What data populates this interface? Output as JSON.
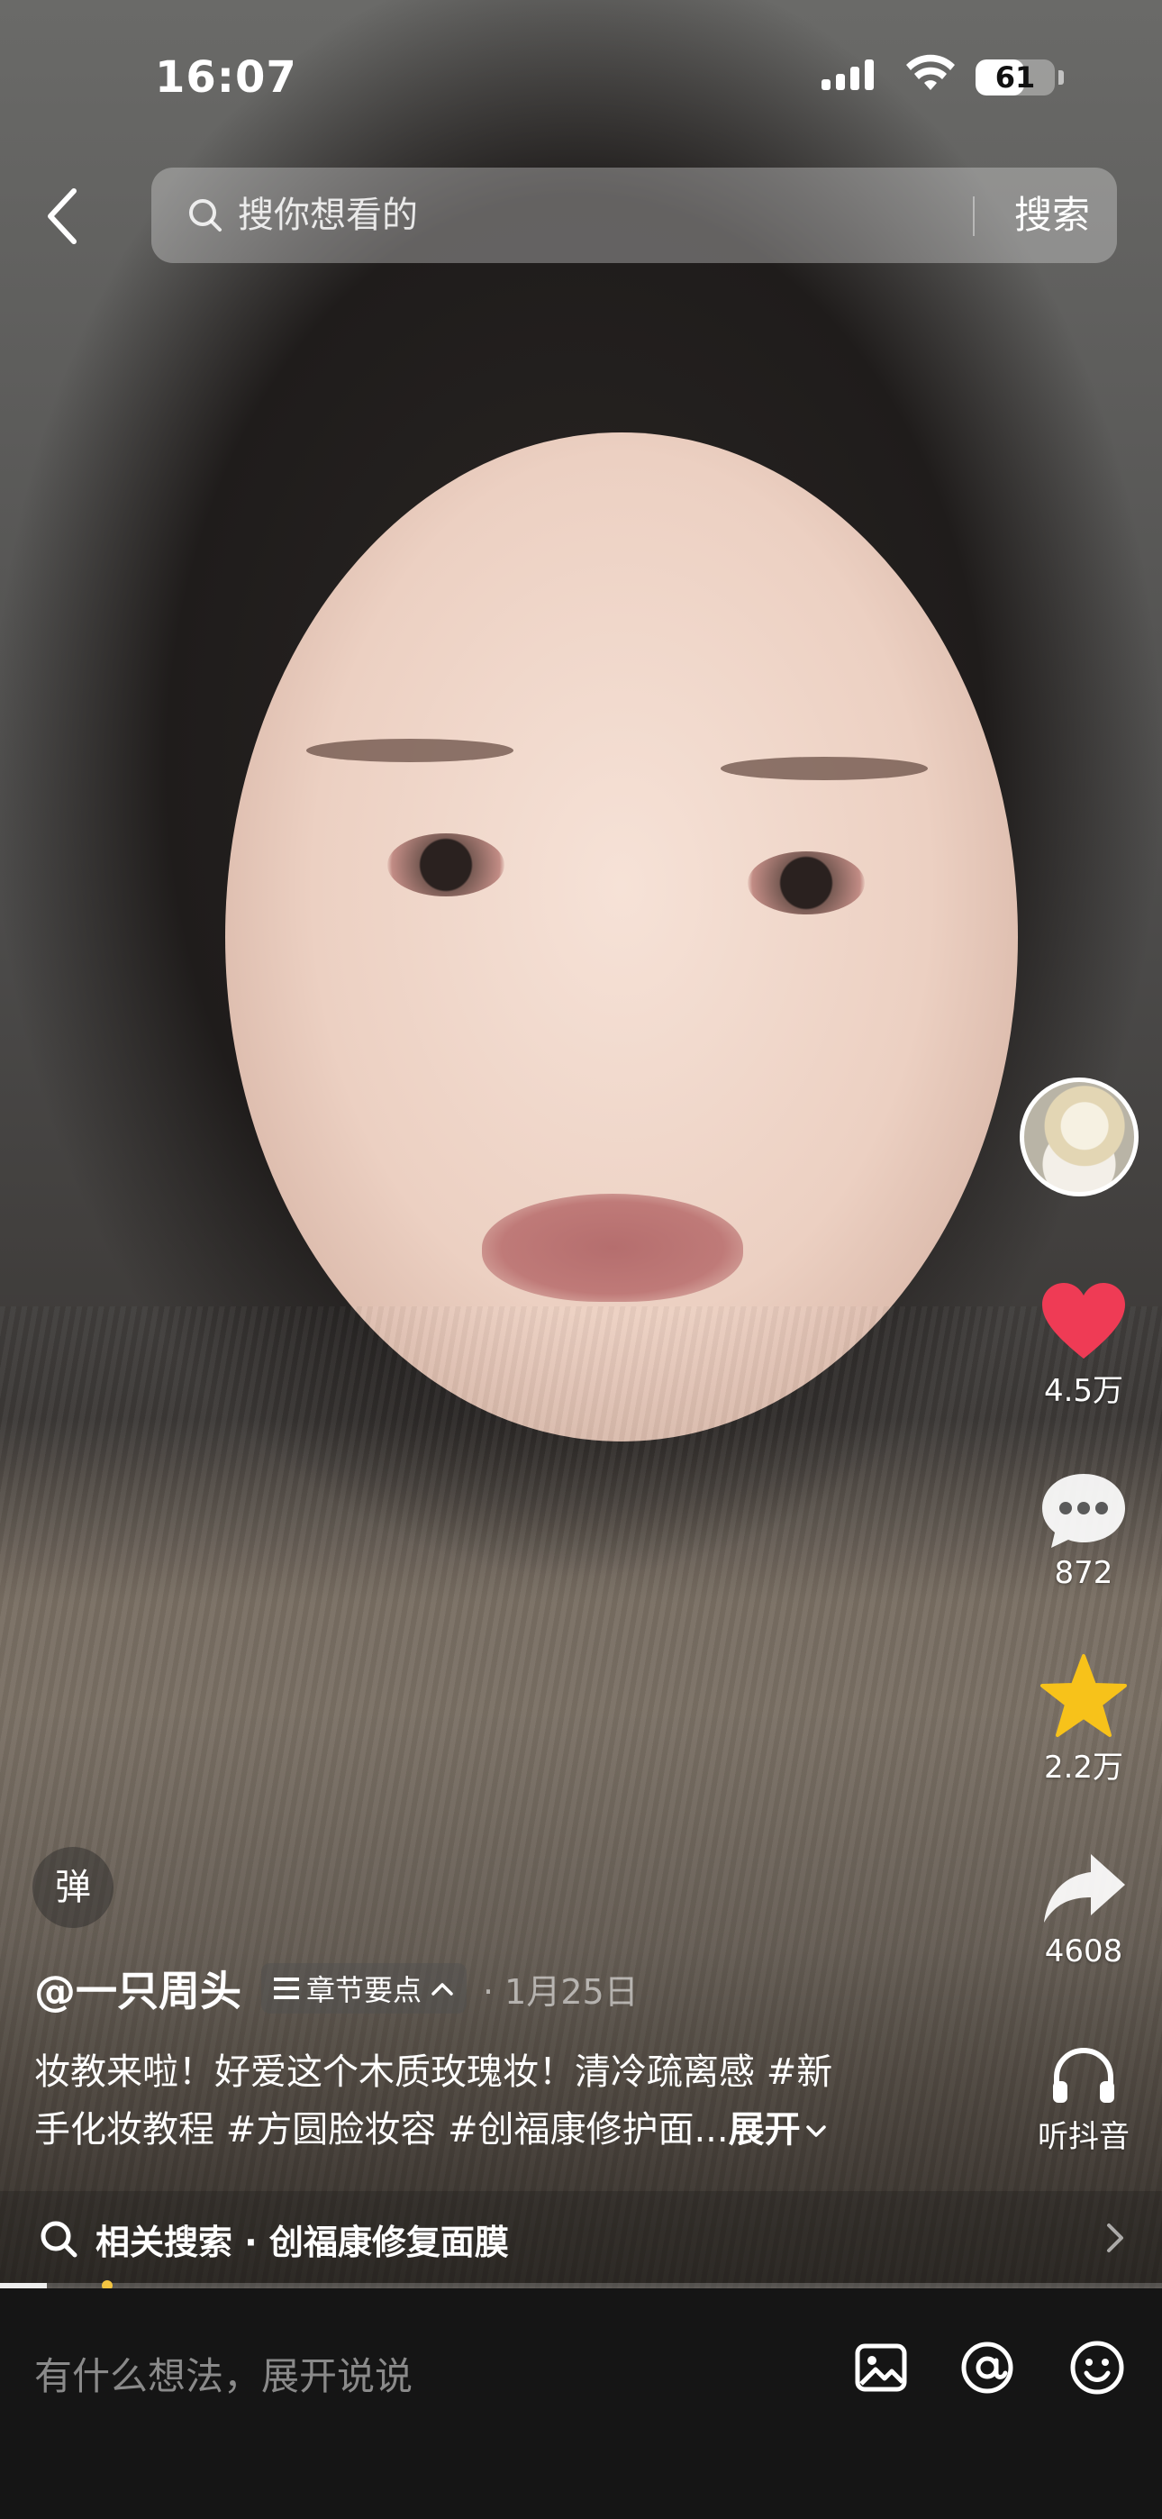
{
  "status_bar": {
    "time": "16:07",
    "battery": "61",
    "battery_level": 0.61
  },
  "search": {
    "placeholder": "搜你想看的",
    "button": "搜索"
  },
  "actions": {
    "like_count": "4.5万",
    "comment_count": "872",
    "favorite_count": "2.2万",
    "share_count": "4608",
    "listen_label": "听抖音"
  },
  "colors": {
    "like": "#ef3b55",
    "favorite": "#f7c21a",
    "progress_marker": "#f4c542"
  },
  "danmaku": {
    "label": "弹"
  },
  "post": {
    "author": "@一只周头",
    "chapter_chip": "章节要点",
    "date": "· 1月25日",
    "desc_line1": "妆教来啦！好爱这个木质玫瑰妆！清冷疏离感 #新",
    "desc_line2": "手化妆教程 #方圆脸妆容 #创福康修护面...",
    "expand": "展开"
  },
  "related_search": {
    "label": "相关搜索 · 创福康修复面膜"
  },
  "progress": {
    "fraction": 0.04
  },
  "comment_bar": {
    "placeholder": "有什么想法，展开说说"
  },
  "icons": [
    "back-icon",
    "search-icon",
    "heart-icon",
    "comment-icon",
    "star-icon",
    "share-icon",
    "headphones-icon",
    "image-icon",
    "at-icon",
    "emoji-icon"
  ]
}
